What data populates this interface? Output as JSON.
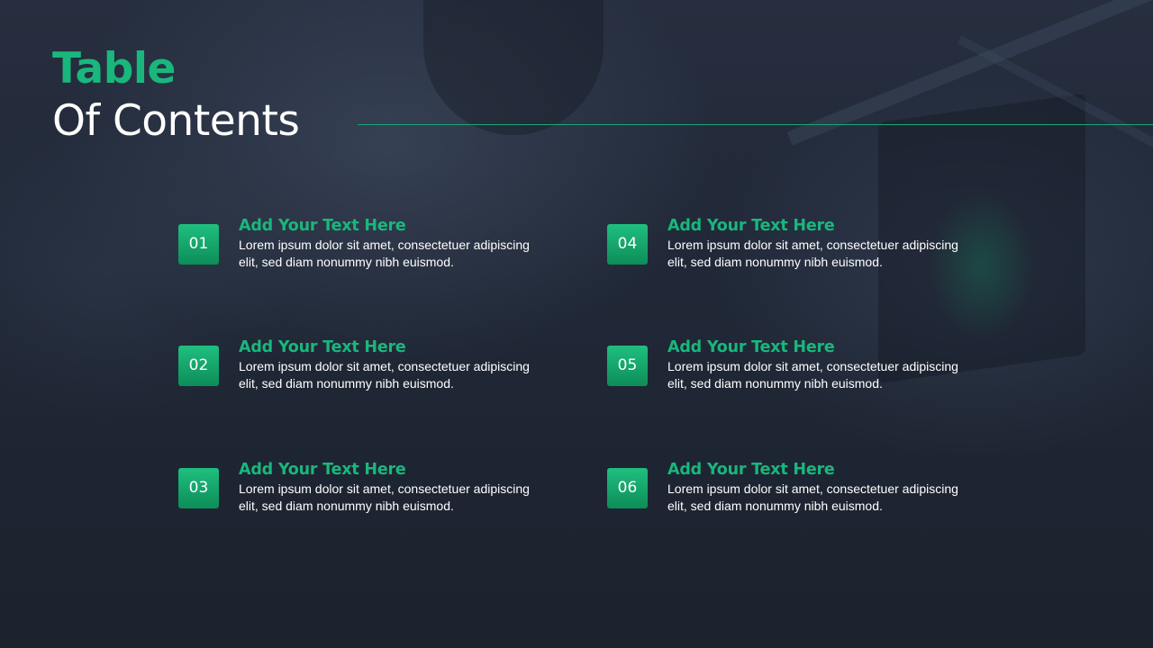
{
  "title": {
    "line1": "Table",
    "line2": "Of Contents"
  },
  "colors": {
    "accent": "#19b77c",
    "background": "#1d2431",
    "text": "#ffffff"
  },
  "items": [
    {
      "number": "01",
      "heading": "Add Your Text Here",
      "body": "Lorem ipsum dolor sit amet, consectetuer adipiscing elit, sed diam nonummy nibh euismod."
    },
    {
      "number": "02",
      "heading": "Add Your Text Here",
      "body": "Lorem ipsum dolor sit amet, consectetuer adipiscing elit, sed diam nonummy nibh euismod."
    },
    {
      "number": "03",
      "heading": "Add Your Text Here",
      "body": "Lorem ipsum dolor sit amet, consectetuer adipiscing elit, sed diam nonummy nibh euismod."
    },
    {
      "number": "04",
      "heading": "Add Your Text Here",
      "body": "Lorem ipsum dolor sit amet, consectetuer adipiscing elit, sed diam nonummy nibh euismod."
    },
    {
      "number": "05",
      "heading": "Add Your Text Here",
      "body": "Lorem ipsum dolor sit amet, consectetuer adipiscing elit, sed diam nonummy nibh euismod."
    },
    {
      "number": "06",
      "heading": "Add Your Text Here",
      "body": "Lorem ipsum dolor sit amet, consectetuer adipiscing elit, sed diam nonummy nibh euismod."
    }
  ]
}
